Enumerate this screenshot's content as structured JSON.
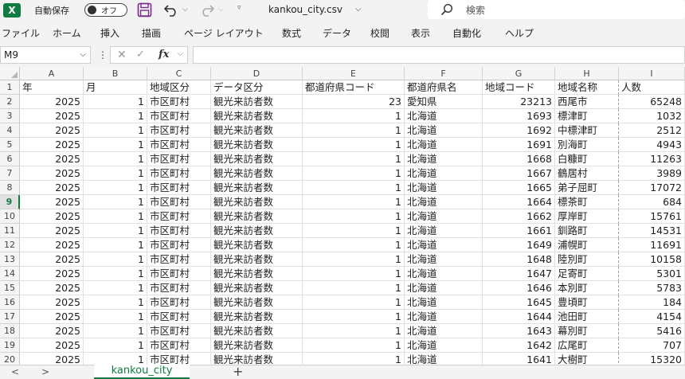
{
  "titlebar": {
    "app_icon": "excel-logo",
    "app_icon_letter": "X",
    "autosave_label": "自動保存",
    "autosave_state": "オフ",
    "filename": "kankou_city.csv",
    "search_placeholder": "検索"
  },
  "ribbon": {
    "tabs": [
      "ファイル",
      "ホーム",
      "挿入",
      "描画",
      "ページ レイアウト",
      "数式",
      "データ",
      "校閲",
      "表示",
      "自動化",
      "ヘルプ"
    ]
  },
  "formula_bar": {
    "name_box": "M9",
    "fx_label": "fx",
    "formula": ""
  },
  "grid": {
    "columns": [
      "A",
      "B",
      "C",
      "D",
      "E",
      "F",
      "G",
      "H",
      "I"
    ],
    "row_numbers": [
      "1",
      "2",
      "3",
      "4",
      "5",
      "6",
      "7",
      "8",
      "9",
      "10",
      "11",
      "12",
      "13",
      "14",
      "15",
      "16",
      "17",
      "18",
      "19",
      "20"
    ],
    "active_row": "9",
    "header_row": [
      "年",
      "月",
      "地域区分",
      "データ区分",
      "都道府県コード",
      "都道府県名",
      "地域コード",
      "地域名称",
      "人数"
    ],
    "rows": [
      [
        "2025",
        "1",
        "市区町村",
        "観光来訪者数",
        "23",
        "愛知県",
        "23213",
        "西尾市",
        "65248"
      ],
      [
        "2025",
        "1",
        "市区町村",
        "観光来訪者数",
        "1",
        "北海道",
        "1693",
        "標津町",
        "1032"
      ],
      [
        "2025",
        "1",
        "市区町村",
        "観光来訪者数",
        "1",
        "北海道",
        "1692",
        "中標津町",
        "2512"
      ],
      [
        "2025",
        "1",
        "市区町村",
        "観光来訪者数",
        "1",
        "北海道",
        "1691",
        "別海町",
        "4943"
      ],
      [
        "2025",
        "1",
        "市区町村",
        "観光来訪者数",
        "1",
        "北海道",
        "1668",
        "白糠町",
        "11263"
      ],
      [
        "2025",
        "1",
        "市区町村",
        "観光来訪者数",
        "1",
        "北海道",
        "1667",
        "鶴居村",
        "3989"
      ],
      [
        "2025",
        "1",
        "市区町村",
        "観光来訪者数",
        "1",
        "北海道",
        "1665",
        "弟子屈町",
        "17072"
      ],
      [
        "2025",
        "1",
        "市区町村",
        "観光来訪者数",
        "1",
        "北海道",
        "1664",
        "標茶町",
        "684"
      ],
      [
        "2025",
        "1",
        "市区町村",
        "観光来訪者数",
        "1",
        "北海道",
        "1662",
        "厚岸町",
        "15761"
      ],
      [
        "2025",
        "1",
        "市区町村",
        "観光来訪者数",
        "1",
        "北海道",
        "1661",
        "釧路町",
        "14531"
      ],
      [
        "2025",
        "1",
        "市区町村",
        "観光来訪者数",
        "1",
        "北海道",
        "1649",
        "浦幌町",
        "11691"
      ],
      [
        "2025",
        "1",
        "市区町村",
        "観光来訪者数",
        "1",
        "北海道",
        "1648",
        "陸別町",
        "10158"
      ],
      [
        "2025",
        "1",
        "市区町村",
        "観光来訪者数",
        "1",
        "北海道",
        "1647",
        "足寄町",
        "5301"
      ],
      [
        "2025",
        "1",
        "市区町村",
        "観光来訪者数",
        "1",
        "北海道",
        "1646",
        "本別町",
        "5783"
      ],
      [
        "2025",
        "1",
        "市区町村",
        "観光来訪者数",
        "1",
        "北海道",
        "1645",
        "豊頃町",
        "184"
      ],
      [
        "2025",
        "1",
        "市区町村",
        "観光来訪者数",
        "1",
        "北海道",
        "1644",
        "池田町",
        "4154"
      ],
      [
        "2025",
        "1",
        "市区町村",
        "観光来訪者数",
        "1",
        "北海道",
        "1643",
        "幕別町",
        "5416"
      ],
      [
        "2025",
        "1",
        "市区町村",
        "観光来訪者数",
        "1",
        "北海道",
        "1642",
        "広尾町",
        "707"
      ],
      [
        "2025",
        "1",
        "市区町村",
        "観光来訪者数",
        "1",
        "北海道",
        "1641",
        "大樹町",
        "15320"
      ]
    ]
  },
  "sheet_tabs": {
    "prev": "<",
    "next": ">",
    "active_tab": "kankou_city",
    "add": "+"
  },
  "colors": {
    "brand": "#107c41",
    "chrome_bg": "#f3f3f3",
    "save_icon": "#7a2a8a"
  }
}
